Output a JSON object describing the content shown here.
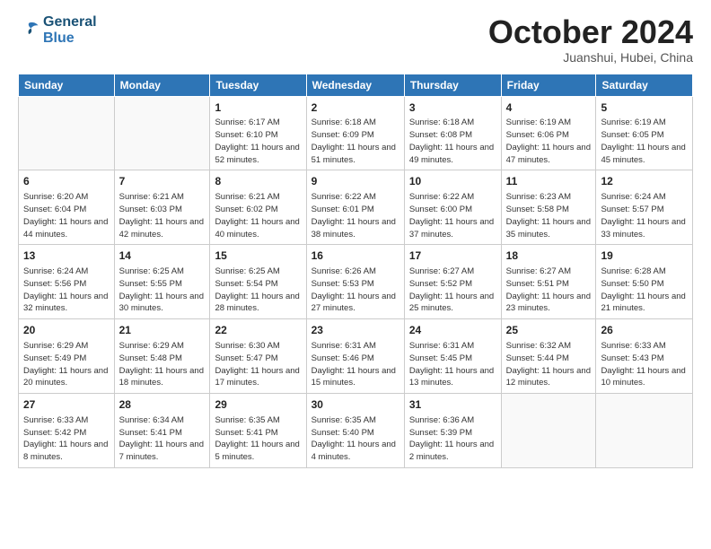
{
  "logo": {
    "line1": "General",
    "line2": "Blue"
  },
  "title": "October 2024",
  "subtitle": "Juanshui, Hubei, China",
  "days_of_week": [
    "Sunday",
    "Monday",
    "Tuesday",
    "Wednesday",
    "Thursday",
    "Friday",
    "Saturday"
  ],
  "weeks": [
    [
      {
        "day": "",
        "info": ""
      },
      {
        "day": "",
        "info": ""
      },
      {
        "day": "1",
        "info": "Sunrise: 6:17 AM\nSunset: 6:10 PM\nDaylight: 11 hours and 52 minutes."
      },
      {
        "day": "2",
        "info": "Sunrise: 6:18 AM\nSunset: 6:09 PM\nDaylight: 11 hours and 51 minutes."
      },
      {
        "day": "3",
        "info": "Sunrise: 6:18 AM\nSunset: 6:08 PM\nDaylight: 11 hours and 49 minutes."
      },
      {
        "day": "4",
        "info": "Sunrise: 6:19 AM\nSunset: 6:06 PM\nDaylight: 11 hours and 47 minutes."
      },
      {
        "day": "5",
        "info": "Sunrise: 6:19 AM\nSunset: 6:05 PM\nDaylight: 11 hours and 45 minutes."
      }
    ],
    [
      {
        "day": "6",
        "info": "Sunrise: 6:20 AM\nSunset: 6:04 PM\nDaylight: 11 hours and 44 minutes."
      },
      {
        "day": "7",
        "info": "Sunrise: 6:21 AM\nSunset: 6:03 PM\nDaylight: 11 hours and 42 minutes."
      },
      {
        "day": "8",
        "info": "Sunrise: 6:21 AM\nSunset: 6:02 PM\nDaylight: 11 hours and 40 minutes."
      },
      {
        "day": "9",
        "info": "Sunrise: 6:22 AM\nSunset: 6:01 PM\nDaylight: 11 hours and 38 minutes."
      },
      {
        "day": "10",
        "info": "Sunrise: 6:22 AM\nSunset: 6:00 PM\nDaylight: 11 hours and 37 minutes."
      },
      {
        "day": "11",
        "info": "Sunrise: 6:23 AM\nSunset: 5:58 PM\nDaylight: 11 hours and 35 minutes."
      },
      {
        "day": "12",
        "info": "Sunrise: 6:24 AM\nSunset: 5:57 PM\nDaylight: 11 hours and 33 minutes."
      }
    ],
    [
      {
        "day": "13",
        "info": "Sunrise: 6:24 AM\nSunset: 5:56 PM\nDaylight: 11 hours and 32 minutes."
      },
      {
        "day": "14",
        "info": "Sunrise: 6:25 AM\nSunset: 5:55 PM\nDaylight: 11 hours and 30 minutes."
      },
      {
        "day": "15",
        "info": "Sunrise: 6:25 AM\nSunset: 5:54 PM\nDaylight: 11 hours and 28 minutes."
      },
      {
        "day": "16",
        "info": "Sunrise: 6:26 AM\nSunset: 5:53 PM\nDaylight: 11 hours and 27 minutes."
      },
      {
        "day": "17",
        "info": "Sunrise: 6:27 AM\nSunset: 5:52 PM\nDaylight: 11 hours and 25 minutes."
      },
      {
        "day": "18",
        "info": "Sunrise: 6:27 AM\nSunset: 5:51 PM\nDaylight: 11 hours and 23 minutes."
      },
      {
        "day": "19",
        "info": "Sunrise: 6:28 AM\nSunset: 5:50 PM\nDaylight: 11 hours and 21 minutes."
      }
    ],
    [
      {
        "day": "20",
        "info": "Sunrise: 6:29 AM\nSunset: 5:49 PM\nDaylight: 11 hours and 20 minutes."
      },
      {
        "day": "21",
        "info": "Sunrise: 6:29 AM\nSunset: 5:48 PM\nDaylight: 11 hours and 18 minutes."
      },
      {
        "day": "22",
        "info": "Sunrise: 6:30 AM\nSunset: 5:47 PM\nDaylight: 11 hours and 17 minutes."
      },
      {
        "day": "23",
        "info": "Sunrise: 6:31 AM\nSunset: 5:46 PM\nDaylight: 11 hours and 15 minutes."
      },
      {
        "day": "24",
        "info": "Sunrise: 6:31 AM\nSunset: 5:45 PM\nDaylight: 11 hours and 13 minutes."
      },
      {
        "day": "25",
        "info": "Sunrise: 6:32 AM\nSunset: 5:44 PM\nDaylight: 11 hours and 12 minutes."
      },
      {
        "day": "26",
        "info": "Sunrise: 6:33 AM\nSunset: 5:43 PM\nDaylight: 11 hours and 10 minutes."
      }
    ],
    [
      {
        "day": "27",
        "info": "Sunrise: 6:33 AM\nSunset: 5:42 PM\nDaylight: 11 hours and 8 minutes."
      },
      {
        "day": "28",
        "info": "Sunrise: 6:34 AM\nSunset: 5:41 PM\nDaylight: 11 hours and 7 minutes."
      },
      {
        "day": "29",
        "info": "Sunrise: 6:35 AM\nSunset: 5:41 PM\nDaylight: 11 hours and 5 minutes."
      },
      {
        "day": "30",
        "info": "Sunrise: 6:35 AM\nSunset: 5:40 PM\nDaylight: 11 hours and 4 minutes."
      },
      {
        "day": "31",
        "info": "Sunrise: 6:36 AM\nSunset: 5:39 PM\nDaylight: 11 hours and 2 minutes."
      },
      {
        "day": "",
        "info": ""
      },
      {
        "day": "",
        "info": ""
      }
    ]
  ]
}
